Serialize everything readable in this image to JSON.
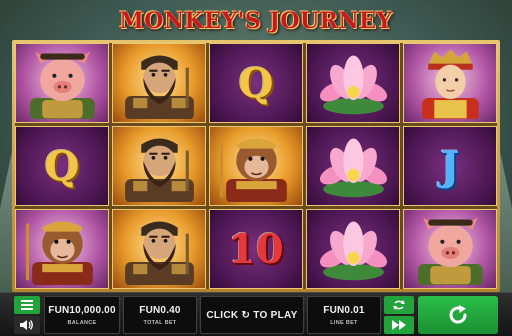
{
  "game": {
    "title": "MONKEY'S JOURNEY"
  },
  "reels": [
    [
      {
        "symbol": "pig-warrior",
        "background": "pink"
      },
      {
        "symbol": "Q",
        "background": "purple",
        "color": "gold"
      },
      {
        "symbol": "monkey-king",
        "background": "pink"
      }
    ],
    [
      {
        "symbol": "bearded-warrior",
        "background": "orange"
      },
      {
        "symbol": "bearded-warrior",
        "background": "orange"
      },
      {
        "symbol": "bearded-warrior",
        "background": "orange"
      }
    ],
    [
      {
        "symbol": "Q",
        "background": "purple",
        "color": "gold"
      },
      {
        "symbol": "monkey-king",
        "background": "orange"
      },
      {
        "symbol": "10",
        "background": "purple",
        "color": "red"
      }
    ],
    [
      {
        "symbol": "lotus",
        "background": "purple"
      },
      {
        "symbol": "lotus",
        "background": "purple"
      },
      {
        "symbol": "lotus",
        "background": "purple"
      }
    ],
    [
      {
        "symbol": "monk",
        "background": "pink"
      },
      {
        "symbol": "J",
        "background": "purple",
        "color": "blue"
      },
      {
        "symbol": "pig-warrior",
        "background": "pink"
      }
    ]
  ],
  "controls": {
    "balance_value": "FUN10,000.00",
    "balance_label": "BALANCE",
    "total_bet_value": "FUN0.40",
    "total_bet_label": "TOTAL BET",
    "click_to_play": "CLICK ↻ TO PLAY",
    "line_bet_value": "FUN0.01",
    "line_bet_label": "LINE BET",
    "menu_icon": "hamburger-menu-icon",
    "sound_icon": "speaker-icon",
    "autoplay_icon": "autoplay-icon",
    "fast_icon": "fast-forward-icon",
    "spin_icon": "spin-icon"
  },
  "colors": {
    "accent_green": "#23a33b",
    "frame_gold": "#e7c56d",
    "title_red": "#c9181c"
  }
}
